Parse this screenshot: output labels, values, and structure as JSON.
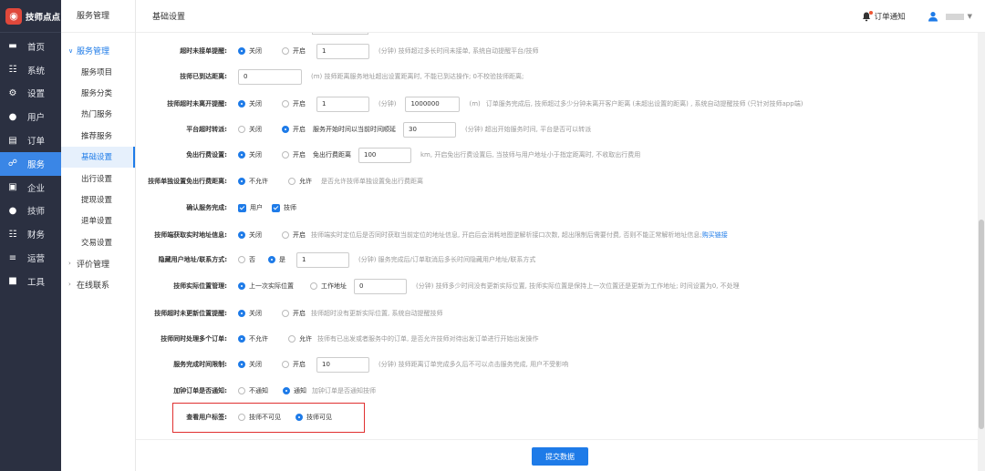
{
  "brand": {
    "name": "技师点点"
  },
  "nav": [
    {
      "label": "首页",
      "icon": "monitor-icon",
      "active": false
    },
    {
      "label": "系统",
      "icon": "hierarchy-icon",
      "active": false
    },
    {
      "label": "设置",
      "icon": "gear-icon",
      "active": false
    },
    {
      "label": "用户",
      "icon": "user-icon",
      "active": false
    },
    {
      "label": "订单",
      "icon": "order-icon",
      "active": false
    },
    {
      "label": "服务",
      "icon": "link-icon",
      "active": true
    },
    {
      "label": "企业",
      "icon": "building-icon",
      "active": false
    },
    {
      "label": "技师",
      "icon": "technician-icon",
      "active": false
    },
    {
      "label": "财务",
      "icon": "finance-icon",
      "active": false
    },
    {
      "label": "运营",
      "icon": "chart-icon",
      "active": false
    },
    {
      "label": "工具",
      "icon": "toolbox-icon",
      "active": false
    }
  ],
  "submenu": {
    "title": "服务管理",
    "group_open": "服务管理",
    "items": [
      "服务项目",
      "服务分类",
      "热门服务",
      "推荐服务",
      "基础设置",
      "出行设置",
      "提现设置",
      "退单设置",
      "交易设置"
    ],
    "active_item": "基础设置",
    "group2": "评价管理",
    "group3": "在线联系"
  },
  "topbar": {
    "breadcrumb": "基础设置",
    "notice": "订单通知"
  },
  "form": {
    "r1": {
      "label": "超时未接单提醒:",
      "o1": "关闭",
      "o2": "开启",
      "value": "1",
      "hint": "(分钟) 技师超过多长时间未接单, 系统自动提醒平台/技师"
    },
    "r2": {
      "label": "技师已到达距离:",
      "value": "0",
      "hint": "(m) 技师距离服务地址超出设置距离时, 不能已到达操作; 0不校验技师距离;"
    },
    "r3": {
      "label": "技师超时未离开提醒:",
      "o1": "关闭",
      "o2": "开启",
      "value": "1",
      "unit": "(分钟)",
      "value2": "1000000",
      "unit2": "(m)",
      "hint": "订单服务完成后, 技师超过多少分钟未离开客户距离 (未超出设置的距离) , 系统自动提醒技师 (只针对技师app端)"
    },
    "r4": {
      "label": "平台超时转派:",
      "o1": "关闭",
      "o2": "开启",
      "inline_label": "服务开始时间以当前时间顺延",
      "value": "30",
      "hint": "(分钟) 超出开始服务时间, 平台是否可以转派"
    },
    "r5": {
      "label": "免出行费设置:",
      "o1": "关闭",
      "o2": "开启",
      "inline_label": "免出行费距离",
      "value": "100",
      "hint": "km, 开启免出行费设置后, 当技师与用户地址小于指定距离时, 不收取出行费用"
    },
    "r6": {
      "label": "技师单独设置免出行费距离:",
      "o1": "不允许",
      "o2": "允许",
      "hint": "是否允许技师单独设置免出行费距离"
    },
    "r7": {
      "label": "确认服务完成:",
      "o1": "用户",
      "o2": "技师"
    },
    "r8": {
      "label": "技师端获取实时地址信息:",
      "o1": "关闭",
      "o2": "开启",
      "hint": "技师端实时定位后是否同时获取当前定位的地址信息, 开启后会消耗地图逆解析接口次数, 超出限制后需要付费, 否则不能正常解析地址信息;",
      "link": "购买链接"
    },
    "r9": {
      "label": "隐藏用户地址/联系方式:",
      "o1": "否",
      "o2": "是",
      "value": "1",
      "hint": "(分钟) 服务完成后/订单取消后多长时间隐藏用户地址/联系方式"
    },
    "r10": {
      "label": "技师实际位置管理:",
      "o1": "上一次实际位置",
      "o2": "工作地址",
      "value": "0",
      "hint": "(分钟) 技师多少时间没有更新实际位置, 技师实际位置是保持上一次位置还是更新为工作地址; 时间设置为0, 不处理"
    },
    "r11": {
      "label": "技师超时未更新位置提醒:",
      "o1": "关闭",
      "o2": "开启",
      "hint": "技师超时没有更新实际位置, 系统自动提醒技师"
    },
    "r12": {
      "label": "技师同时处理多个订单:",
      "o1": "不允许",
      "o2": "允许",
      "hint": "技师有已出发或者服务中的订单, 是否允许技师对待出发订单进行开始出发操作"
    },
    "r13": {
      "label": "服务完成时间限制:",
      "o1": "关闭",
      "o2": "开启",
      "value": "10",
      "hint": "(分钟) 技师距离订单完成多久后不可以点击服务完成, 用户不受影响"
    },
    "r14": {
      "label": "加钟订单是否通知:",
      "o1": "不通知",
      "o2": "通知",
      "hint": "加钟订单是否通知技师"
    },
    "r15": {
      "label": "查看用户标签:",
      "o1": "技师不可见",
      "o2": "技师可见"
    }
  },
  "footer": {
    "submit": "提交数据"
  }
}
